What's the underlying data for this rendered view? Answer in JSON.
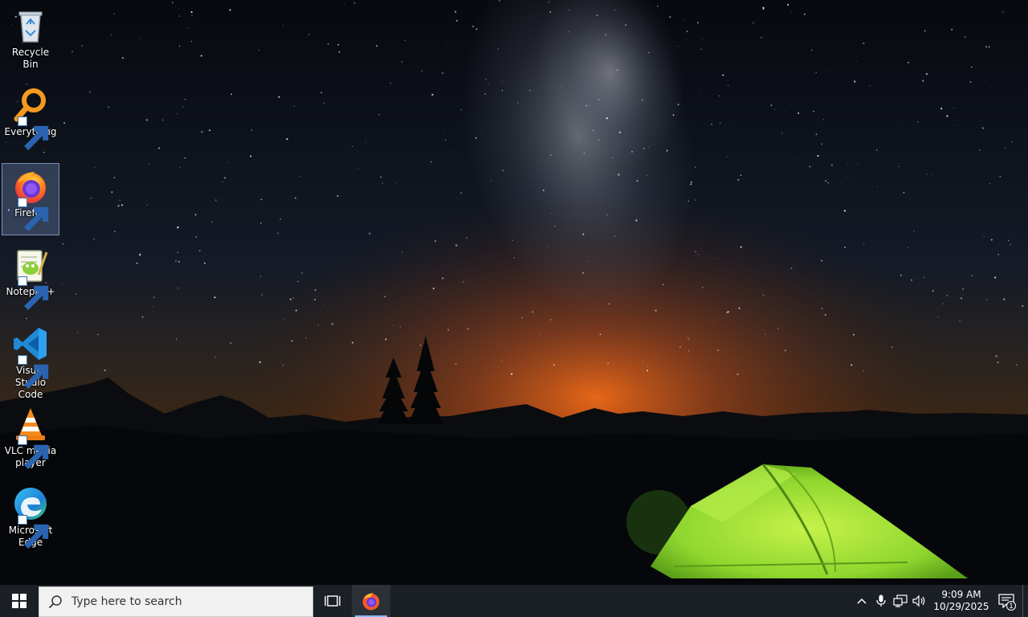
{
  "desktop_icons": [
    {
      "label": "Recycle Bin",
      "icon": "recycle-bin-icon"
    },
    {
      "label": "Everything",
      "icon": "everything-search-icon"
    },
    {
      "label": "Firefox",
      "icon": "firefox-icon",
      "selected": true
    },
    {
      "label": "Notepad++",
      "icon": "notepad-plus-plus-icon"
    },
    {
      "label": "Visual Studio Code",
      "icon": "vscode-icon"
    },
    {
      "label": "VLC media player",
      "icon": "vlc-icon"
    },
    {
      "label": "Microsoft Edge",
      "icon": "edge-icon"
    }
  ],
  "taskbar": {
    "search_placeholder": "Type here to search",
    "pinned": [
      {
        "name": "Firefox",
        "icon": "firefox-icon",
        "active": true
      }
    ],
    "clock": {
      "time": "9:09 AM",
      "date": "10/29/2025"
    },
    "notification_count": "1"
  },
  "colors": {
    "taskbar_bg": "#1b1f26",
    "sky": "#0b1020",
    "horizon_glow": "#e4641c",
    "tent": "#9ee23a"
  }
}
